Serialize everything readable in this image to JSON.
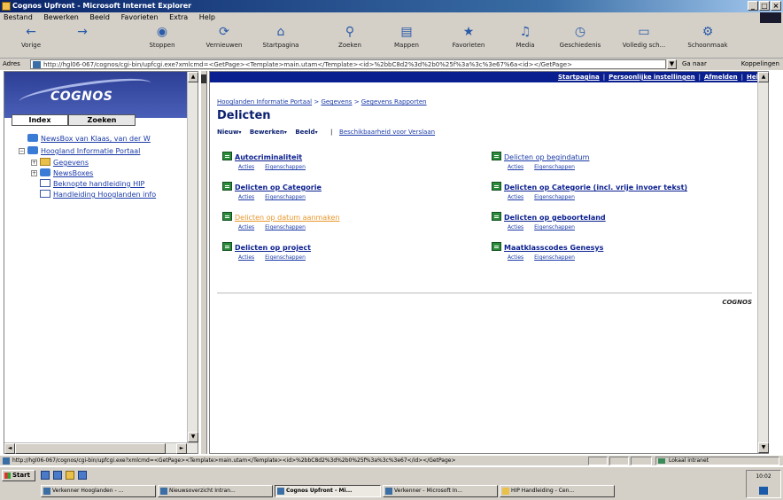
{
  "window": {
    "title": "Cognos Upfront - Microsoft Internet Explorer",
    "controls": [
      "_",
      "□",
      "×"
    ]
  },
  "menu": [
    "Bestand",
    "Bewerken",
    "Beeld",
    "Favorieten",
    "Extra",
    "Help"
  ],
  "toolbar": [
    {
      "label": "Vorige",
      "icon": "back-arrow-icon"
    },
    {
      "label": "",
      "icon": "forward-arrow-icon"
    },
    {
      "label": "Stoppen",
      "icon": "stop-icon"
    },
    {
      "label": "Vernieuwen",
      "icon": "refresh-icon"
    },
    {
      "label": "Startpagina",
      "icon": "home-icon"
    },
    {
      "label": "Zoeken",
      "icon": "search-icon"
    },
    {
      "label": "Mappen",
      "icon": "folders-icon"
    },
    {
      "label": "Favorieten",
      "icon": "favorites-icon"
    },
    {
      "label": "Media",
      "icon": "media-icon"
    },
    {
      "label": "Geschiedenis",
      "icon": "history-icon"
    },
    {
      "label": "Volledig sch...",
      "icon": "fullscreen-icon"
    },
    {
      "label": "Schoonmaak",
      "icon": "tools-icon"
    }
  ],
  "address": {
    "label": "Adres",
    "url": "http://hgl06-067/cognos/cgi-bin/upfcgi.exe?xmlcmd=<GetPage><Template>main.utam</Template><id>%2bbC8d2%3d%2b0%25f%3a%3c%3e67%6a<id></GetPage>",
    "go": "Ga naar",
    "links": "Koppelingen"
  },
  "left": {
    "logo": "COGNOS",
    "tabs": [
      "Index",
      "Zoeken"
    ],
    "tree": [
      {
        "label": "NewsBox van Klaas, van der W",
        "icon": "globe-icon",
        "indent": 0,
        "expander": ""
      },
      {
        "label": "Hoogland Informatie Portaal",
        "icon": "globe-icon",
        "indent": 0,
        "expander": "−"
      },
      {
        "label": "Gegevens",
        "icon": "folder-icon",
        "indent": 1,
        "expander": "+"
      },
      {
        "label": "NewsBoxes",
        "icon": "globe-icon",
        "indent": 1,
        "expander": "+"
      },
      {
        "label": "Beknopte handleiding HIP",
        "icon": "doc-icon",
        "indent": 1,
        "expander": ""
      },
      {
        "label": "Handleiding Hooglanden info",
        "icon": "doc-icon",
        "indent": 1,
        "expander": ""
      }
    ]
  },
  "main": {
    "nav": {
      "links": [
        "Startpagina",
        "Persoonlijke instellingen",
        "Afmelden",
        "Help"
      ],
      "separator": "|"
    },
    "breadcrumb": [
      "Hooglanden Informatie Portaal",
      "Gegevens",
      "Gegevens Rapporten"
    ],
    "breadcrumb_sep": ">",
    "title": "Delicten",
    "tools": [
      "Nieuw",
      "Bewerken",
      "Beeld"
    ],
    "sort_link": "Beschikbaarheid voor Verslaan",
    "actions": [
      "Acties",
      "Eigenschappen"
    ],
    "left_items": [
      {
        "name": "Autocriminaliteit",
        "style": "bold"
      },
      {
        "name": "Delicten op Categorie",
        "style": "bold"
      },
      {
        "name": "Delicten op datum aanmaken",
        "style": "visited"
      },
      {
        "name": "Delicten op project",
        "style": "bold"
      }
    ],
    "right_items": [
      {
        "name": "Delicten op begindatum",
        "style": "plain"
      },
      {
        "name": "Delicten op Categorie (incl. vrije invoer tekst)",
        "style": "bold"
      },
      {
        "name": "Delicten op geboorteland",
        "style": "bold"
      },
      {
        "name": "Maatklasscodes Genesys",
        "style": "bold"
      }
    ],
    "footer_logo": "COGNOS"
  },
  "status": {
    "message": "http://hgl06-067/cognos/cgi-bin/upfcgi.exe?xmlcmd=<GetPage><Template>main.utam</Template><id>%2bbC8d2%3d%2b0%25f%3a%3c%3e67</id></GetPage>",
    "zone": "Lokaal intranet"
  },
  "taskbar": {
    "start": "Start",
    "tasks": [
      {
        "label": "Verkenner Hooglanden - ...",
        "active": false,
        "type": "ie"
      },
      {
        "label": "Nieuwsoverzicht Intran...",
        "active": false,
        "type": "ie"
      },
      {
        "label": "Cognos Upfront - Mi...",
        "active": true,
        "type": "ie"
      },
      {
        "label": "Verkenner - Microsoft In...",
        "active": false,
        "type": "ie"
      },
      {
        "label": "HIP Handleiding - Cen...",
        "active": false,
        "type": "pdf"
      }
    ],
    "clock": "10:02"
  }
}
